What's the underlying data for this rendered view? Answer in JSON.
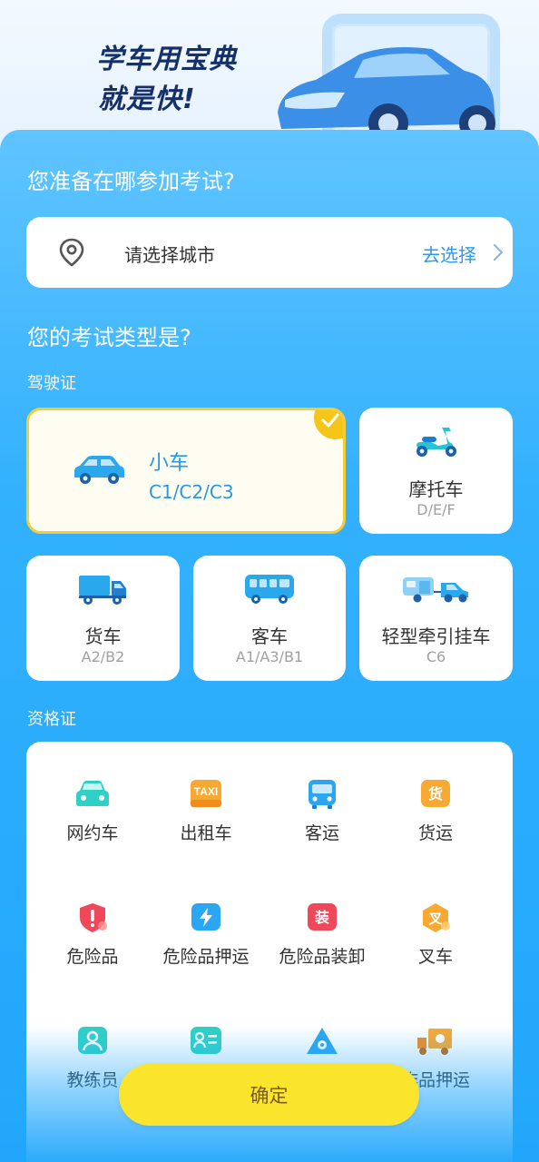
{
  "banner": {
    "line1": "学车用宝典",
    "line2": "就是快!"
  },
  "city": {
    "title": "您准备在哪参加考试?",
    "placeholder": "请选择城市",
    "action": "去选择"
  },
  "exam": {
    "title": "您的考试类型是?",
    "license_label": "驾驶证",
    "licenses": [
      {
        "name": "小车",
        "code": "C1/C2/C3",
        "icon": "car-icon",
        "selected": true
      },
      {
        "name": "摩托车",
        "code": "D/E/F",
        "icon": "motorcycle-icon",
        "selected": false
      },
      {
        "name": "货车",
        "code": "A2/B2",
        "icon": "truck-icon",
        "selected": false
      },
      {
        "name": "客车",
        "code": "A1/A3/B1",
        "icon": "bus-icon",
        "selected": false
      },
      {
        "name": "轻型牵引挂车",
        "code": "C6",
        "icon": "trailer-icon",
        "selected": false
      }
    ],
    "qual_label": "资格证",
    "quals": [
      {
        "name": "网约车",
        "icon": "ride-hailing-icon"
      },
      {
        "name": "出租车",
        "icon": "taxi-icon",
        "badge": "TAXI"
      },
      {
        "name": "客运",
        "icon": "passenger-bus-icon"
      },
      {
        "name": "货运",
        "icon": "freight-icon",
        "badge": "货"
      },
      {
        "name": "危险品",
        "icon": "hazard-icon"
      },
      {
        "name": "危险品押运",
        "icon": "hazard-escort-icon"
      },
      {
        "name": "危险品装卸",
        "icon": "hazard-loading-icon",
        "badge": "装"
      },
      {
        "name": "叉车",
        "icon": "forklift-icon",
        "badge": "叉"
      },
      {
        "name": "教练员",
        "icon": "coach-icon"
      },
      {
        "name": "",
        "icon": "id-card-icon"
      },
      {
        "name": "",
        "icon": "explosive-icon"
      },
      {
        "name": "作品押运",
        "icon": "explosive-truck-icon"
      }
    ]
  },
  "confirm_label": "确定",
  "colors": {
    "accent": "#2598e8",
    "selected_border": "#f3cc3a",
    "confirm": "#fbe52c"
  }
}
